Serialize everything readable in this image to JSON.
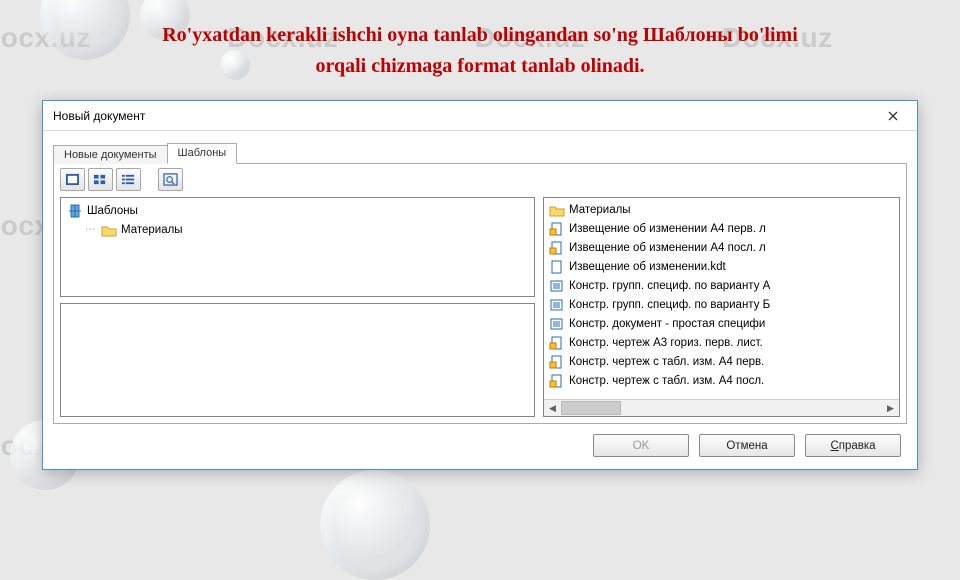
{
  "watermark": "Docx.uz",
  "caption_line1": "Ro'yxatdan kerakli  ishchi oyna tanlab olingandan so'ng Шаблоны bo'limi",
  "caption_line2": "orqali chizmaga format tanlab olinadi.",
  "dialog": {
    "title": "Новый документ",
    "tabs": {
      "new": "Новые документы",
      "templates": "Шаблоны"
    },
    "tree": {
      "root": "Шаблоны",
      "child": "Материалы"
    },
    "list": {
      "items": [
        "Материалы",
        "Извещение об изменении А4 перв. л",
        "Извещение об изменении А4 посл. л",
        "Извещение об изменении.kdt",
        "Констр. групп. специф. по варианту А",
        "Констр. групп. специф. по варианту Б",
        "Констр. документ - простая специфи",
        "Констр. чертеж А3 гориз. перв. лист.",
        "Констр. чертеж c табл. изм. А4 перв.",
        "Констр. чертеж c табл. изм. А4 посл."
      ]
    },
    "buttons": {
      "ok": "OK",
      "cancel": "Отмена",
      "help_pre": "С",
      "help_post": "правка"
    }
  }
}
